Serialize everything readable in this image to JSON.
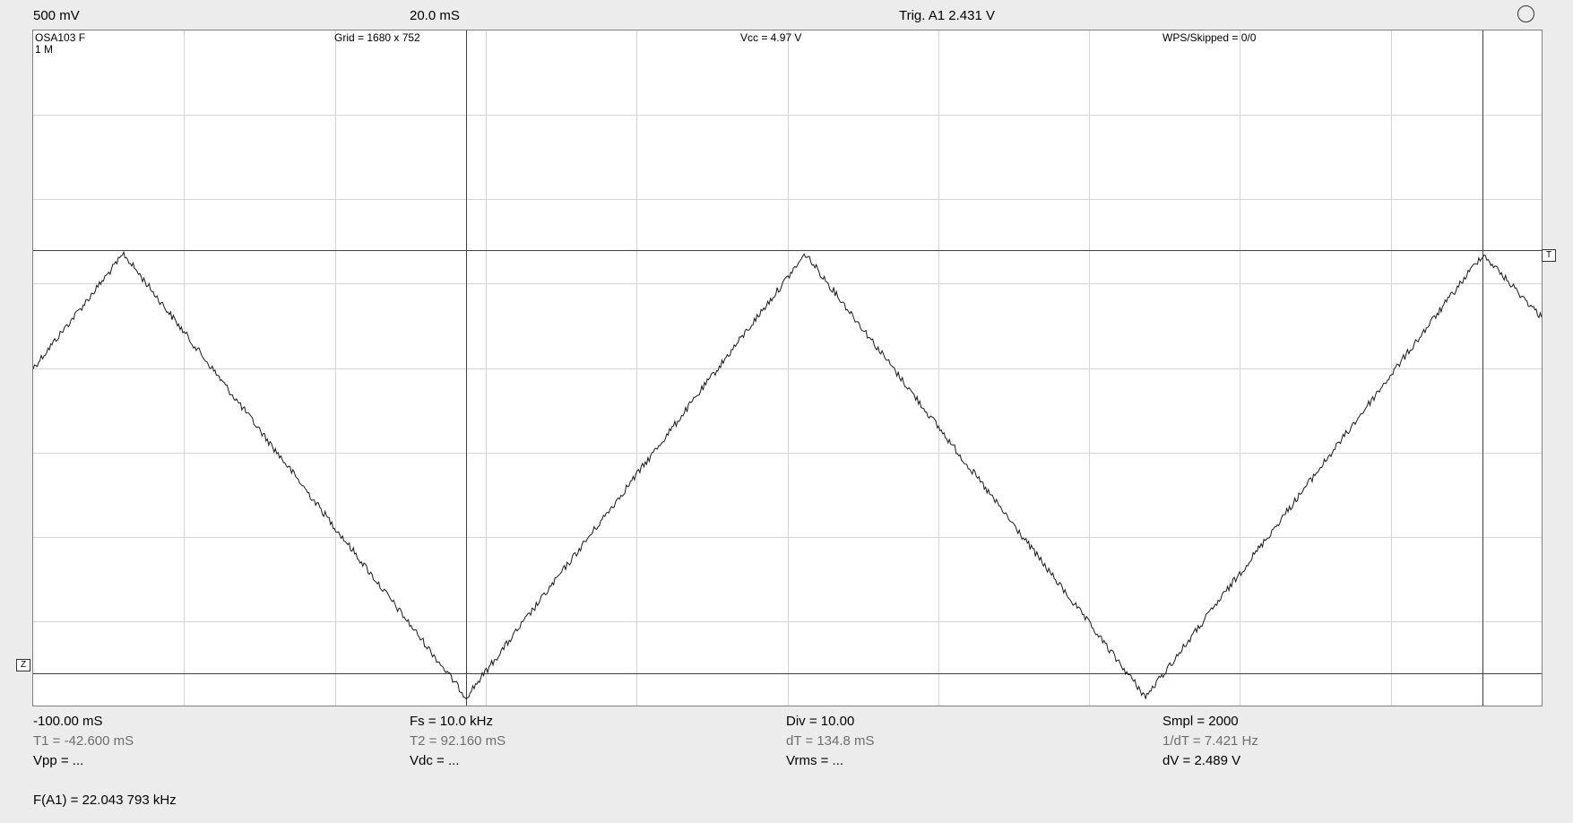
{
  "top": {
    "volts_div": "500 mV",
    "time_div": "20.0 mS",
    "trigger": "Trig. A1  2.431 V"
  },
  "overlay": {
    "device": "OSA103 F",
    "mode": "1 M",
    "grid": "Grid = 1680 x 752",
    "vcc": "Vcc = 4.97 V",
    "wps": "WPS/Skipped  = 0/0"
  },
  "markers": {
    "trigger_marker": "T",
    "zero_marker": "Z"
  },
  "bottom": {
    "row1": [
      "-100.00 mS",
      "Fs = 10.0 kHz",
      "Div = 10.00",
      "Smpl = 2000"
    ],
    "row2": [
      "T1 = -42.600 mS",
      "T2 = 92.160 mS",
      "dT = 134.8 mS",
      "1/dT = 7.421 Hz"
    ],
    "row3": [
      "Vpp = ...",
      "Vdc = ...",
      "Vrms = ...",
      "dV = 2.489 V"
    ],
    "freq": "F(A1) = 22.043 793 kHz"
  },
  "chart_data": {
    "type": "line",
    "xlabel": "",
    "ylabel": "",
    "xlim": [
      -100,
      100
    ],
    "ylim": [
      0,
      8
    ],
    "grid": true,
    "series": [
      {
        "x": [
          -100,
          -88,
          -42.6,
          2.4,
          47.5,
          92.2,
          100
        ],
        "y": [
          4.0,
          5.35,
          0.1,
          5.35,
          0.1,
          5.35,
          4.6
        ]
      }
    ],
    "cursors": {
      "t1": -42.6,
      "t2": 92.16,
      "v_high": 5.4,
      "v_low": 0.38
    },
    "colors": {
      "trace": "#1a1a1a",
      "grid": "#d4d4d4",
      "cursor": "#404040"
    }
  }
}
